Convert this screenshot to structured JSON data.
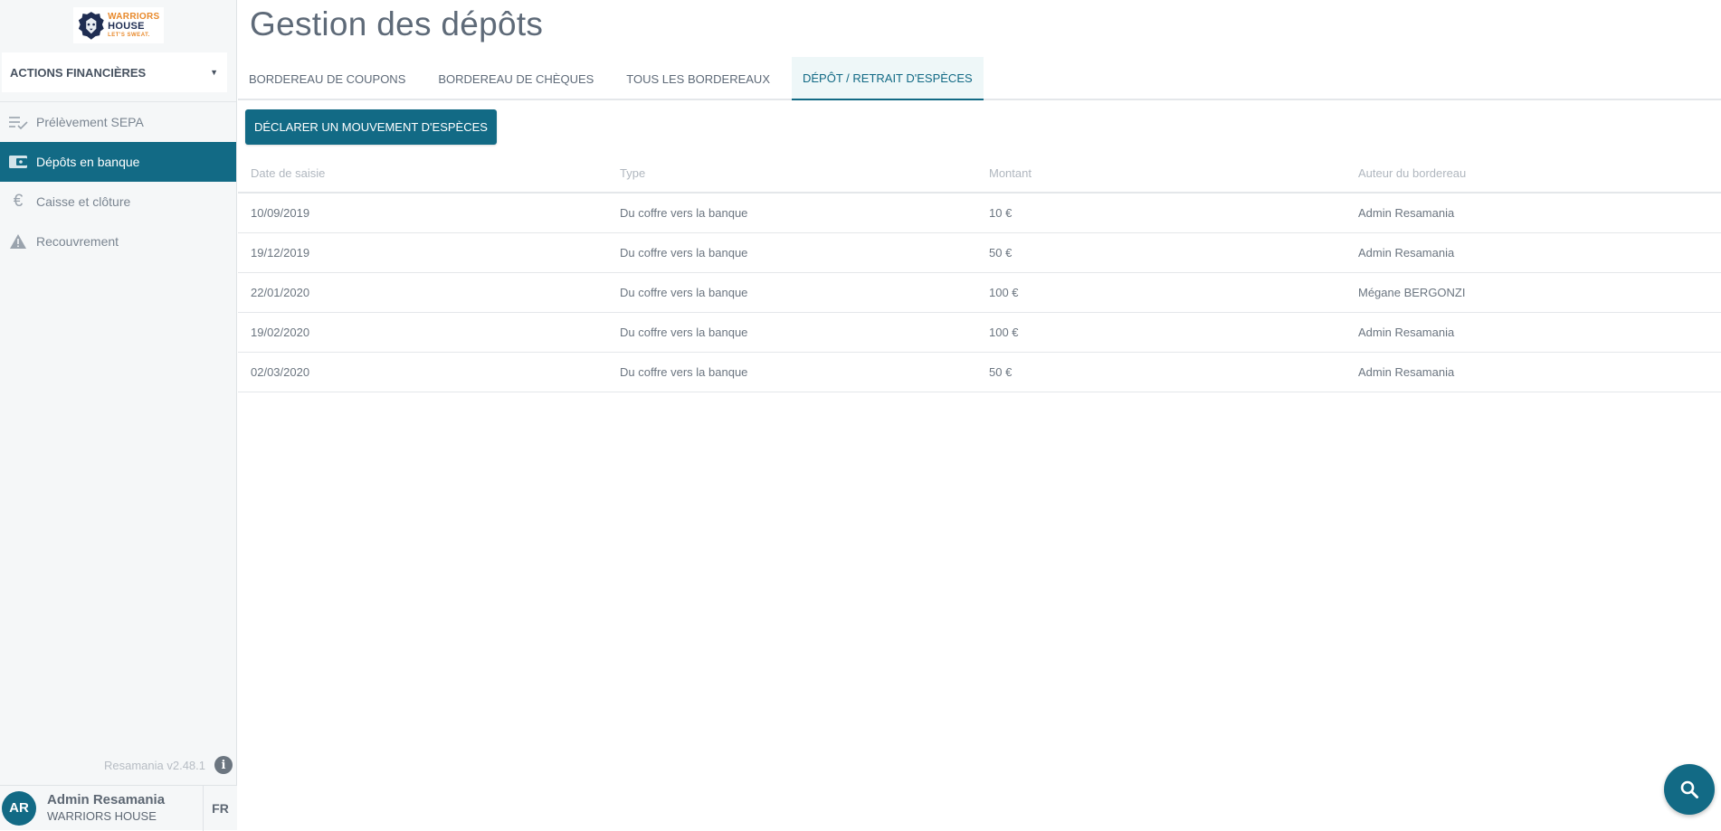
{
  "logo": {
    "line1": "WARRIORS",
    "line2": "HOUSE",
    "line3": "LET'S SWEAT."
  },
  "sidebar": {
    "section_select": "ACTIONS FINANCIÈRES",
    "items": [
      {
        "label": "Prélèvement SEPA",
        "icon": "checklist-icon",
        "active": false
      },
      {
        "label": "Dépôts en banque",
        "icon": "wallet-icon",
        "active": true
      },
      {
        "label": "Caisse et clôture",
        "icon": "euro-icon",
        "active": false
      },
      {
        "label": "Recouvrement",
        "icon": "warning-icon",
        "active": false
      }
    ],
    "version": "Resamania v2.48.1"
  },
  "user": {
    "initials": "AR",
    "name": "Admin Resamania",
    "org": "WARRIORS HOUSE",
    "lang": "FR"
  },
  "page": {
    "title": "Gestion des dépôts"
  },
  "tabs": [
    {
      "label": "BORDEREAU DE COUPONS",
      "active": false
    },
    {
      "label": "BORDEREAU DE CHÈQUES",
      "active": false
    },
    {
      "label": "TOUS LES BORDEREAUX",
      "active": false
    },
    {
      "label": "DÉPÔT / RETRAIT D'ESPÈCES",
      "active": true
    }
  ],
  "action_button": "DÉCLARER UN MOUVEMENT D'ESPÈCES",
  "table": {
    "headers": [
      "Date de saisie",
      "Type",
      "Montant",
      "Auteur du bordereau"
    ],
    "rows": [
      [
        "10/09/2019",
        "Du coffre vers la banque",
        "10 €",
        "Admin Resamania"
      ],
      [
        "19/12/2019",
        "Du coffre vers la banque",
        "50 €",
        "Admin Resamania"
      ],
      [
        "22/01/2020",
        "Du coffre vers la banque",
        "100 €",
        "Mégane BERGONZI"
      ],
      [
        "19/02/2020",
        "Du coffre vers la banque",
        "100 €",
        "Admin Resamania"
      ],
      [
        "02/03/2020",
        "Du coffre vers la banque",
        "50 €",
        "Admin Resamania"
      ]
    ]
  },
  "colors": {
    "accent": "#126a85",
    "sidebar_bg": "#f5f7f8"
  }
}
